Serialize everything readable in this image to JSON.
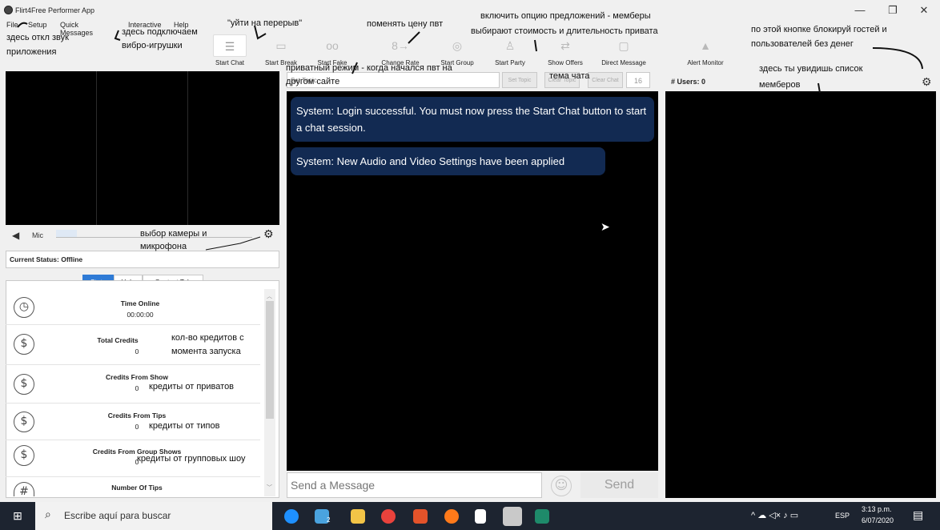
{
  "window": {
    "title": "Flirt4Free Performer App",
    "minimize": "—",
    "restore": "❐",
    "close": "✕"
  },
  "menu": [
    "File",
    "Setup",
    "Quick Messages",
    "Interactive",
    "Help"
  ],
  "toolbar": [
    {
      "label": "Start Chat",
      "icon": "list-icon",
      "glyph": "☰"
    },
    {
      "label": "Start Break",
      "icon": "briefcase-icon",
      "glyph": "▭"
    },
    {
      "label": "Start Fake",
      "icon": "glasses-icon",
      "glyph": "oo"
    },
    {
      "label": "Change Rate",
      "icon": "rate-icon",
      "glyph": "8→"
    },
    {
      "label": "Start Group",
      "icon": "group-icon",
      "glyph": "◎"
    },
    {
      "label": "Start Party",
      "icon": "party-icon",
      "glyph": "♙"
    },
    {
      "label": "Show Offers",
      "icon": "offers-icon",
      "glyph": "⇄"
    },
    {
      "label": "Direct Message",
      "icon": "message-icon",
      "glyph": "▢"
    },
    {
      "label": "Alert Monitor",
      "icon": "alert-icon",
      "glyph": "▲"
    }
  ],
  "mic": {
    "label": "Mic"
  },
  "status": {
    "text": "Current Status: Offline"
  },
  "tabs": [
    "Stats",
    "Help",
    "Contest Tab"
  ],
  "stats": [
    {
      "label": "Time Online",
      "value": "00:00:00",
      "icon": "clock-icon",
      "glyph": "◷"
    },
    {
      "label": "Total Credits",
      "value": "0",
      "icon": "dollar-icon",
      "glyph": "$"
    },
    {
      "label": "Credits From Show",
      "value": "0",
      "icon": "dollar-icon",
      "glyph": "$"
    },
    {
      "label": "Credits From Tips",
      "value": "0",
      "icon": "dollar-icon",
      "glyph": "$"
    },
    {
      "label": "Credits From Group Shows",
      "value": "0",
      "icon": "dollar-icon",
      "glyph": "$"
    },
    {
      "label": "Number Of Tips",
      "value": "",
      "icon": "hash-icon",
      "glyph": "#"
    }
  ],
  "chat": {
    "topic_placeholder": "Set Topic",
    "set_topic": "Set Topic",
    "clear_topic": "Clear Topic",
    "clear_chat": "Clear Chat",
    "font_size": "16",
    "messages": [
      "System: Login successful. You must now press the Start Chat button to start a chat session.",
      "System: New Audio and Video Settings have been applied"
    ],
    "input_placeholder": "Send a Message",
    "send": "Send"
  },
  "users": {
    "count_label": "# Users: 0"
  },
  "annotations": {
    "a1": "здесь откл звук",
    "a1b": "приложения",
    "a2": "здесь подключаем",
    "a2b": "вибро-игрушки",
    "a3": "\"уйти на перерыв\"",
    "a4": "поменять цену пвт",
    "a5": "включить опцию предложений - мемберы",
    "a5b": "выбирают стоимость и длительность привата",
    "a6": "по этой кнопке блокируй гостей и",
    "a6b": "пользователей без денег",
    "a7": "приватный режим - когда начался пвт на",
    "a7b": "другом сайте",
    "a8": "тема чата",
    "a9": "здесь ты увидишь список",
    "a9b": "мемберов",
    "a10": "выбор камеры и",
    "a10b": "микрофона",
    "a11": "кол-во кредитов с",
    "a11b": "момента запуска",
    "a12": "кредиты от приватов",
    "a13": "кредиты от типов",
    "a14": "кредиты от групповых шоу"
  },
  "taskbar": {
    "search": "Escribe aquí para buscar",
    "lang": "ESP",
    "time": "3:13 p.m.",
    "date": "6/07/2020",
    "badge": "2"
  }
}
